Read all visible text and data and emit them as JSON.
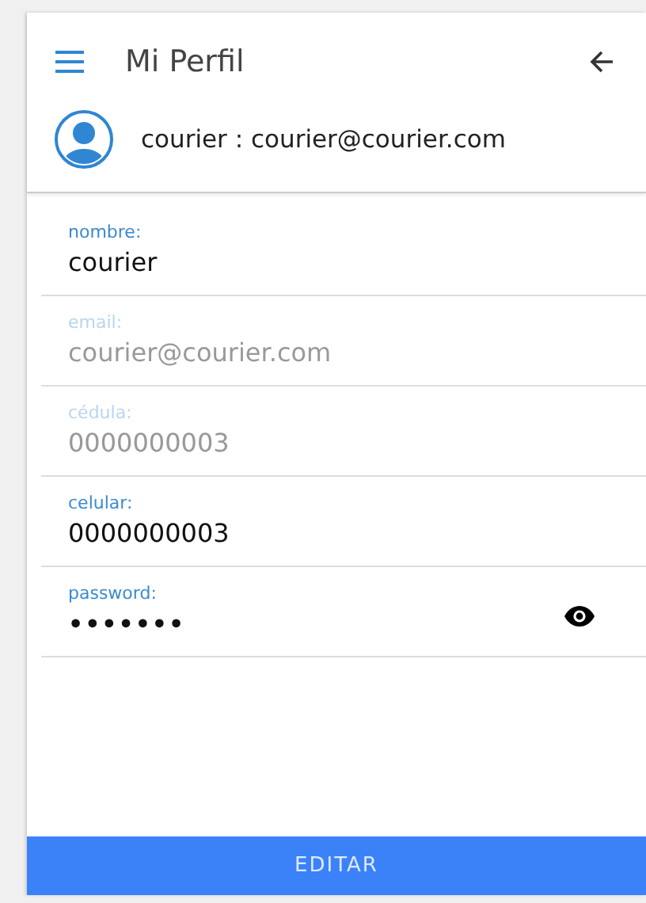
{
  "header": {
    "title": "Mi Perfil",
    "user": "courier : courier@courier.com"
  },
  "fields": [
    {
      "kind": "text",
      "label": "nombre:",
      "value": "courier",
      "disabled": false
    },
    {
      "kind": "text",
      "label": "email:",
      "value": "courier@courier.com",
      "disabled": true
    },
    {
      "kind": "text",
      "label": "cédula:",
      "value": "0000000003",
      "disabled": true
    },
    {
      "kind": "text",
      "label": "celular:",
      "value": "0000000003",
      "disabled": false
    },
    {
      "kind": "password",
      "label": "password:",
      "value": "•••••••",
      "disabled": false
    }
  ],
  "button": "EDITAR"
}
